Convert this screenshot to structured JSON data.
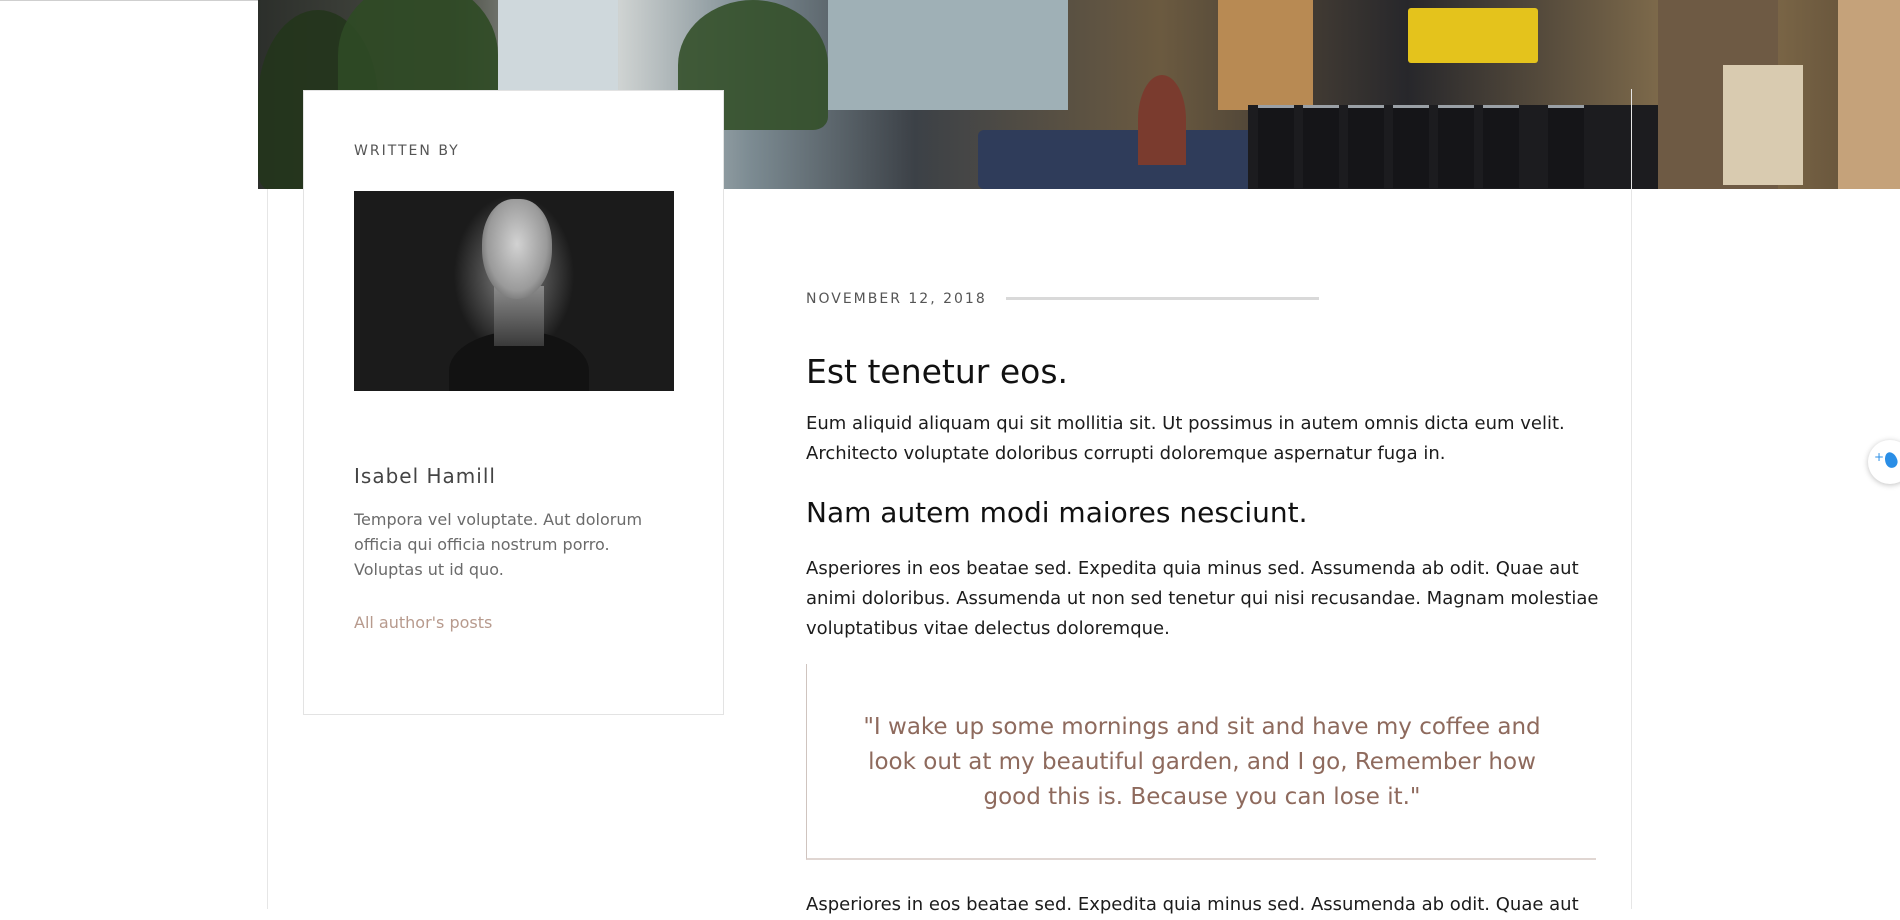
{
  "hero": {
    "image_name": "cafe-interior-hero"
  },
  "author": {
    "heading": "WRITTEN BY",
    "photo_name": "author-portrait",
    "name": "Isabel Hamill",
    "bio": "Tempora vel voluptate. Aut dolorum officia qui officia nostrum porro. Voluptas ut id quo.",
    "posts_link": "All author's posts"
  },
  "post": {
    "date": "NOVEMBER 12, 2018",
    "title": "Est tenetur eos.",
    "paragraph1": "Eum aliquid aliquam qui sit mollitia sit. Ut possimus in autem omnis dicta eum velit. Architecto voluptate doloribus corrupti doloremque aspernatur fuga in.",
    "subtitle": "Nam autem modi maiores nesciunt.",
    "paragraph2": "Asperiores in eos beatae sed. Expedita quia minus sed. Assumenda ab odit. Quae aut animi doloribus. Assumenda ut non sed tenetur qui nisi recusandae. Magnam molestiae voluptatibus vitae delectus doloremque.",
    "quote": "\"I wake up some mornings and sit and have my coffee and look out at my beautiful garden, and I go, Remember how good this is. Because you can lose it.\"",
    "paragraph3": "Asperiores in eos beatae sed. Expedita quia minus sed. Assumenda ab odit. Quae aut"
  },
  "widget": {
    "icon_name": "water-drop-icon",
    "plus": "+"
  },
  "colors": {
    "accent": "#8e6a5d",
    "link": "#b79a8d",
    "border": "#e3e3e3"
  }
}
